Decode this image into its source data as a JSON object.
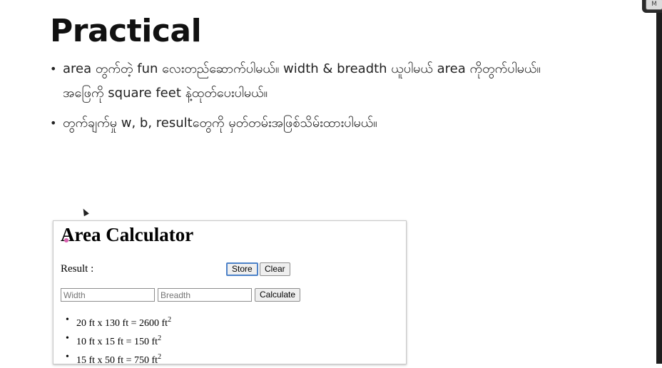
{
  "slide": {
    "title": "Practical",
    "bullets": [
      {
        "text": "area တွက်တဲ့ fun လေးတည်ဆောက်ပါမယ်။ width & breadth ယူပါမယ် area ကိုတွက်ပါမယ်။အဖြေကို square feet နဲ့ထုတ်ပေးပါမယ်။"
      },
      {
        "text": "တွက်ချက်မှု w, b, resultတွေကို မှတ်တမ်းအဖြစ်သိမ်းထားပါမယ်။"
      }
    ]
  },
  "corner_badge": "M",
  "app": {
    "title": "Area Calculator",
    "result_label": "Result :",
    "store_label": "Store",
    "clear_label": "Clear",
    "width_placeholder": "Width",
    "width_value": "",
    "breadth_placeholder": "Breadth",
    "breadth_value": "",
    "calculate_label": "Calculate",
    "results": [
      {
        "text": "20 ft x 130 ft = 2600 ft",
        "sup": "2"
      },
      {
        "text": "10 ft x 15 ft = 150 ft",
        "sup": "2"
      },
      {
        "text": "15 ft x 50 ft = 750 ft",
        "sup": "2"
      }
    ]
  }
}
